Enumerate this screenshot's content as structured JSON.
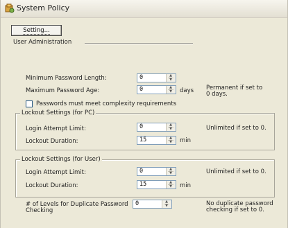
{
  "window": {
    "title": "System Policy"
  },
  "toolbar": {
    "setting_label": "Setting..."
  },
  "user_admin": {
    "heading": "User Administration",
    "min_length_label": "Minimum Password Length:",
    "min_length_value": "0",
    "max_age_label": "Maximum Password Age:",
    "max_age_value": "0",
    "max_age_unit": "days",
    "max_age_note_1": "Permanent if set to",
    "max_age_note_2": "0 days.",
    "complexity_label": "Passwords must meet complexity requirements",
    "complexity_checked": false
  },
  "lockout_pc": {
    "legend": "Lockout Settings (for PC)",
    "attempt_label": "Login Attempt Limit:",
    "attempt_value": "0",
    "attempt_note": "Unlimited if set to 0.",
    "duration_label": "Lockout Duration:",
    "duration_value": "15",
    "duration_unit": "min"
  },
  "lockout_user": {
    "legend": "Lockout Settings (for User)",
    "attempt_label": "Login Attempt Limit:",
    "attempt_value": "0",
    "attempt_note": "Unlimited if set to 0.",
    "duration_label": "Lockout Duration:",
    "duration_value": "15",
    "duration_unit": "min"
  },
  "duplicate": {
    "label_1": "# of Levels for Duplicate Password",
    "label_2": "Checking",
    "value": "0",
    "note_1": "No duplicate password",
    "note_2": "checking if set to 0."
  }
}
